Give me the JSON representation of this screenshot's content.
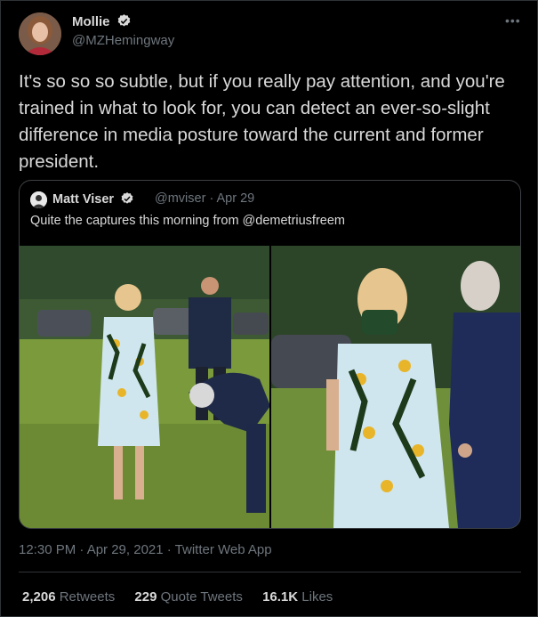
{
  "author": {
    "name": "Mollie",
    "handle": "@MZHemingway"
  },
  "more_label": "•••",
  "tweet_text": "It's so so so subtle, but if you really pay attention, and you're trained in what to look for, you can detect an ever-so-slight difference in media posture toward the current and former president.",
  "quoted": {
    "name": "Matt Viser",
    "handle": "@mviser",
    "date": "Apr 29",
    "meta": "@mviser · Apr 29",
    "text": "Quite the captures this morning from @demetriusfreem"
  },
  "timestamp": "12:30 PM · Apr 29, 2021 · Twitter Web App",
  "stats": {
    "retweets_count": "2,206",
    "retweets_label": "Retweets",
    "quotes_count": "229",
    "quotes_label": "Quote Tweets",
    "likes_count": "16.1K",
    "likes_label": "Likes"
  },
  "colors": {
    "background": "#000000",
    "text": "#d9d9d9",
    "muted": "#6e767d",
    "border": "#2f3336",
    "verified": "#d9d9d9"
  }
}
